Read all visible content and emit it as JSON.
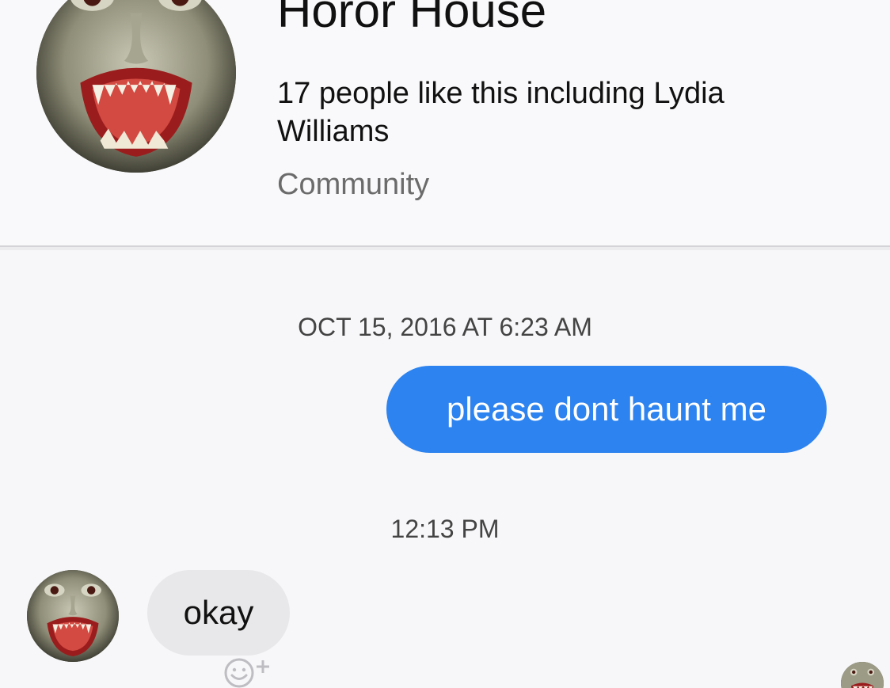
{
  "header": {
    "title": "Horor House",
    "likes_text": "17 people like this including Lydia Williams",
    "category": "Community"
  },
  "conversation": {
    "timestamps": [
      "OCT 15, 2016 AT 6:23 AM",
      "12:13 PM"
    ],
    "messages": [
      {
        "direction": "sent",
        "text": "please dont haunt me"
      },
      {
        "direction": "received",
        "text": "okay"
      }
    ]
  },
  "icons": {
    "profile_avatar": "vampire-face-avatar",
    "reaction": "smiley-add-icon",
    "seen": "seen-avatar-icon"
  },
  "colors": {
    "sent_bubble": "#2d83ef",
    "received_bubble": "#e8e8ea",
    "background": "#f7f7f9",
    "muted_text": "#6b6b6b"
  }
}
